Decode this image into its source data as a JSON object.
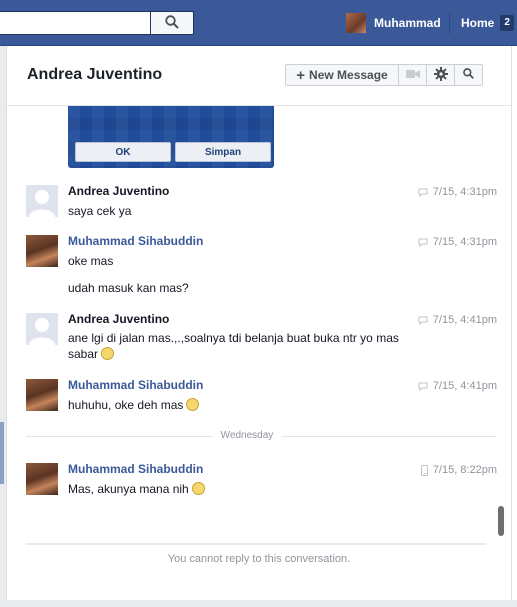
{
  "topbar": {
    "user_name": "Muhammad",
    "home_label": "Home",
    "home_count": "2"
  },
  "conversation": {
    "title": "Andrea Juventino",
    "new_message_label": "New Message"
  },
  "attachment": {
    "button_ok": "OK",
    "button_save": "Simpan"
  },
  "messages": [
    {
      "author": "Andrea Juventino",
      "time": "7/15, 4:31pm",
      "lines": [
        "saya cek ya"
      ]
    },
    {
      "author": "Muhammad Sihabuddin",
      "time": "7/15, 4:31pm",
      "lines": [
        "oke mas",
        "udah masuk kan mas?"
      ]
    },
    {
      "author": "Andrea Juventino",
      "time": "7/15, 4:41pm",
      "lines": [
        "ane lgi di jalan mas.,.,soalnya tdi belanja buat buka ntr yo mas",
        "sabar"
      ]
    },
    {
      "author": "Muhammad Sihabuddin",
      "time": "7/15, 4:41pm",
      "lines": [
        "huhuhu, oke deh mas"
      ]
    },
    {
      "author": "Muhammad Sihabuddin",
      "time": "7/15, 8:22pm",
      "lines": [
        "Mas, akunya mana nih"
      ]
    }
  ],
  "day_separator": "Wednesday",
  "footer_notice": "You cannot reply to this conversation."
}
